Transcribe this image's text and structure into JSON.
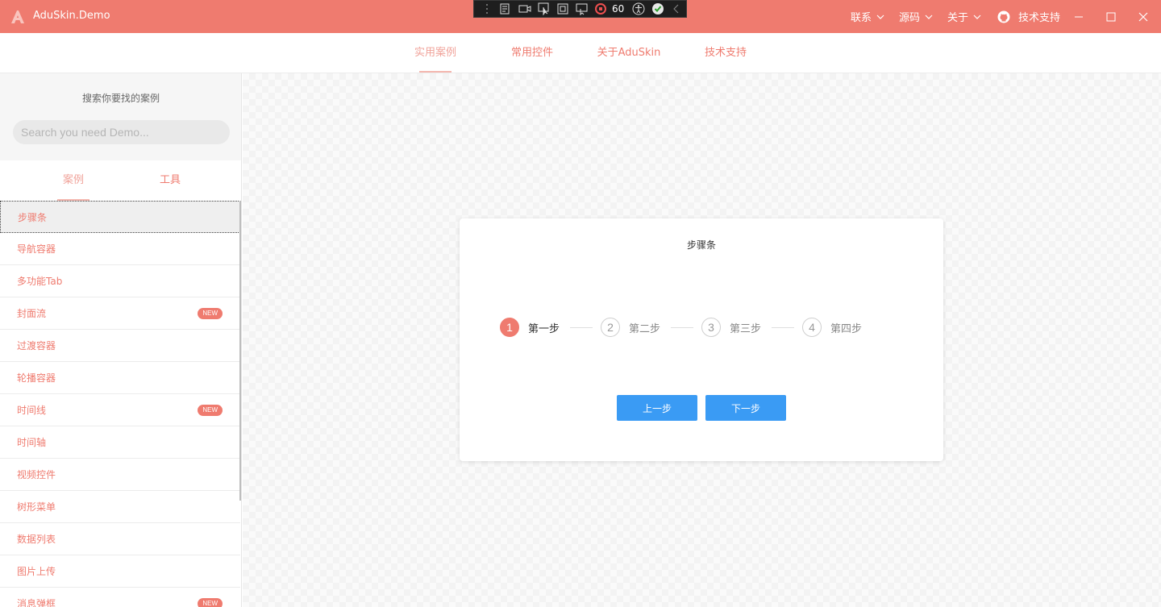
{
  "window": {
    "title": "AduSkin.Demo",
    "menus": [
      {
        "label": "联系"
      },
      {
        "label": "源码"
      },
      {
        "label": "关于"
      }
    ],
    "support_label": "技术支持",
    "accent": "#ef7b6f"
  },
  "devbar": {
    "fps": "60"
  },
  "topnav": {
    "items": [
      {
        "label": "实用案例"
      },
      {
        "label": "常用控件"
      },
      {
        "label": "关于AduSkin"
      },
      {
        "label": "技术支持"
      }
    ]
  },
  "sidebar": {
    "search_title": "搜索你要找的案例",
    "search_placeholder": "Search you need Demo...",
    "tabs": [
      {
        "label": "案例"
      },
      {
        "label": "工具"
      }
    ],
    "badge_text": "NEW",
    "items": [
      {
        "label": "步骤条",
        "is_new": false
      },
      {
        "label": "导航容器",
        "is_new": false
      },
      {
        "label": "多功能Tab",
        "is_new": false
      },
      {
        "label": "封面流",
        "is_new": true
      },
      {
        "label": "过渡容器",
        "is_new": false
      },
      {
        "label": "轮播容器",
        "is_new": false
      },
      {
        "label": "时间线",
        "is_new": true
      },
      {
        "label": "时间轴",
        "is_new": false
      },
      {
        "label": "视频控件",
        "is_new": false
      },
      {
        "label": "树形菜单",
        "is_new": false
      },
      {
        "label": "数据列表",
        "is_new": false
      },
      {
        "label": "图片上传",
        "is_new": false
      },
      {
        "label": "消息弹框",
        "is_new": true
      }
    ]
  },
  "card": {
    "title": "步骤条",
    "steps": [
      {
        "number": "1",
        "label": "第一步"
      },
      {
        "number": "2",
        "label": "第二步"
      },
      {
        "number": "3",
        "label": "第三步"
      },
      {
        "number": "4",
        "label": "第四步"
      }
    ],
    "prev_label": "上一步",
    "next_label": "下一步",
    "button_color": "#3a9bf4"
  }
}
